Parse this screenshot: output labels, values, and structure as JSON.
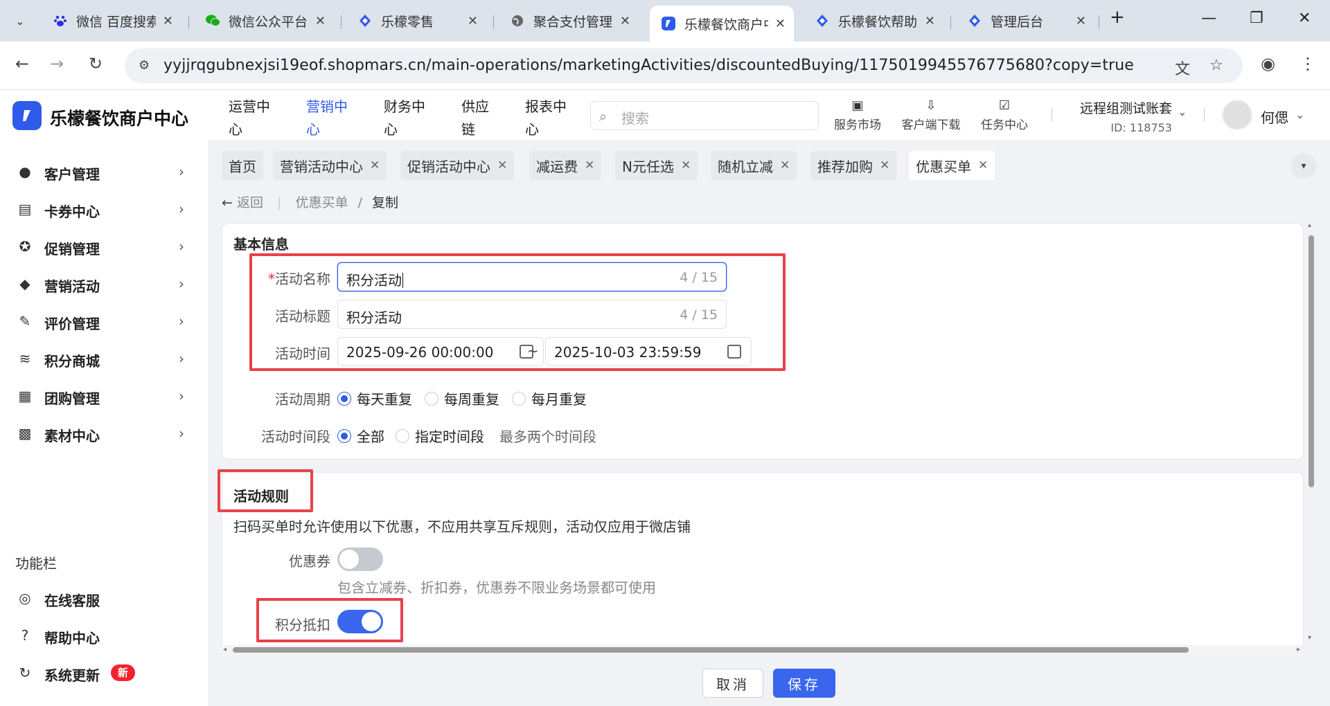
{
  "browser": {
    "tabs": [
      {
        "title": "微信 百度搜索",
        "icon": "baidu-paw-icon",
        "active": false
      },
      {
        "title": "微信公众平台",
        "icon": "wechat-icon",
        "active": false
      },
      {
        "title": "乐檬零售",
        "icon": "lemeng-diamond-icon",
        "active": false
      },
      {
        "title": "聚合支付管理",
        "icon": "globe-icon",
        "active": false
      },
      {
        "title": "乐檬餐饮商户中心",
        "icon": "lemeng-logo-icon",
        "active": true
      },
      {
        "title": "乐檬餐饮帮助中心",
        "icon": "lemeng-diamond-icon",
        "active": false
      },
      {
        "title": "管理后台",
        "icon": "lemeng-diamond-icon",
        "active": false
      }
    ],
    "url": "yyjjrqgubnexjsi19eof.shopmars.cn/main-operations/marketingActivities/discountedBuying/1175019945576775680?copy=true",
    "close_glyph": "✕",
    "new_tab_glyph": "+",
    "minimize_glyph": "—",
    "restore_glyph": "❐",
    "window_close_glyph": "✕",
    "back_glyph": "←",
    "forward_glyph": "→",
    "reload_glyph": "↻",
    "star_glyph": "☆",
    "menu_glyph": "⋮"
  },
  "header": {
    "brand": "乐檬餐饮商户中心",
    "nav": [
      {
        "line1": "运营中",
        "line2": "心",
        "active": false
      },
      {
        "line1": "营销中",
        "line2": "心",
        "active": true
      },
      {
        "line1": "财务中",
        "line2": "心",
        "active": false
      },
      {
        "line1": "供应",
        "line2": "链",
        "active": false
      },
      {
        "line1": "报表中",
        "line2": "心",
        "active": false
      }
    ],
    "search_placeholder": "搜索",
    "tools": [
      {
        "label": "服务市场",
        "icon": "store-icon"
      },
      {
        "label": "客户端下载",
        "icon": "download-icon"
      },
      {
        "label": "任务中心",
        "icon": "clipboard-check-icon"
      }
    ],
    "account_name": "远程组测试账套",
    "account_id": "ID: 118753",
    "user_name": "何偲"
  },
  "sidebar": {
    "items": [
      {
        "label": "客户管理",
        "icon": "user-icon"
      },
      {
        "label": "卡券中心",
        "icon": "ticket-icon"
      },
      {
        "label": "促销管理",
        "icon": "percent-badge-icon"
      },
      {
        "label": "营销活动",
        "icon": "tag-icon"
      },
      {
        "label": "评价管理",
        "icon": "edit-note-icon"
      },
      {
        "label": "积分商城",
        "icon": "coins-stack-icon"
      },
      {
        "label": "团购管理",
        "icon": "gift-icon"
      },
      {
        "label": "素材中心",
        "icon": "image-icon"
      }
    ],
    "function_title": "功能栏",
    "function_items": [
      {
        "label": "在线客服",
        "icon": "headset-icon"
      },
      {
        "label": "帮助中心",
        "icon": "help-circle-icon"
      },
      {
        "label": "系统更新",
        "icon": "refresh-icon",
        "badge": "新"
      }
    ]
  },
  "page_tabs": [
    {
      "label": "首页",
      "closable": false,
      "active": false
    },
    {
      "label": "营销活动中心",
      "closable": true,
      "active": false
    },
    {
      "label": "促销活动中心",
      "closable": true,
      "active": false
    },
    {
      "label": "减运费",
      "closable": true,
      "active": false
    },
    {
      "label": "N元任选",
      "closable": true,
      "active": false
    },
    {
      "label": "随机立减",
      "closable": true,
      "active": false
    },
    {
      "label": "推荐加购",
      "closable": true,
      "active": false
    },
    {
      "label": "优惠买单",
      "closable": true,
      "active": true
    }
  ],
  "breadcrumb": {
    "back": "返回",
    "parent": "优惠买单",
    "sep": "/",
    "current": "复制"
  },
  "basic_info": {
    "title": "基本信息",
    "name_label": "活动名称",
    "name_value": "积分活动",
    "name_count": "4 / 15",
    "subtitle_label": "活动标题",
    "subtitle_value": "积分活动",
    "subtitle_count": "4 / 15",
    "time_label": "活动时间",
    "start_time": "2025-09-26 00:00:00",
    "end_time": "2025-10-03 23:59:59",
    "range_sep": "~",
    "cycle_label": "活动周期",
    "cycle_options": [
      {
        "label": "每天重复",
        "checked": true
      },
      {
        "label": "每周重复",
        "checked": false
      },
      {
        "label": "每月重复",
        "checked": false
      }
    ],
    "period_label": "活动时间段",
    "period_options": [
      {
        "label": "全部",
        "checked": true
      },
      {
        "label": "指定时间段",
        "checked": false
      }
    ],
    "period_hint": "最多两个时间段"
  },
  "rules": {
    "title": "活动规则",
    "description": "扫码买单时允许使用以下优惠，不应用共享互斥规则，活动仅应用于微店铺",
    "coupon_label": "优惠券",
    "coupon_enabled": false,
    "coupon_hint": "包含立减券、折扣券，优惠券不限业务场景都可使用",
    "points_label": "积分抵扣",
    "points_enabled": true
  },
  "footer": {
    "cancel": "取消",
    "save": "保存"
  },
  "colors": {
    "primary": "#2f5bea",
    "highlight_box": "#e8424b",
    "badge": "#f5222d"
  }
}
